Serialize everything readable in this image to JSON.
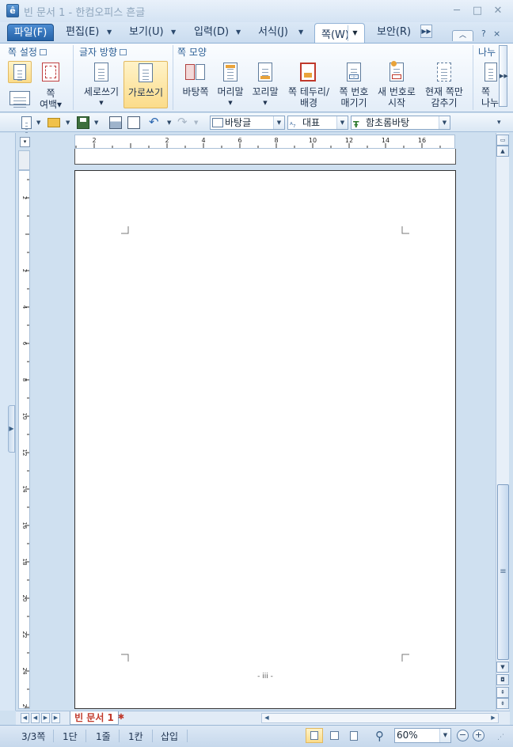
{
  "window": {
    "title": "빈 문서 1 - 한컴오피스 흔글",
    "controls": {
      "minimize": "─",
      "maximize": "□",
      "close": "✕"
    }
  },
  "menu": {
    "tabs": [
      {
        "label": "파일(F)"
      },
      {
        "label": "편집(E)"
      },
      {
        "label": "보기(U)"
      },
      {
        "label": "입력(D)"
      },
      {
        "label": "서식(J)"
      },
      {
        "label": "쪽(W)"
      },
      {
        "label": "보안(R)"
      }
    ],
    "active_tab": "쪽(W)",
    "help": "?",
    "close": "×"
  },
  "ribbon": {
    "groups": {
      "page_setup": {
        "title": "쪽 설정",
        "margin_label": "쪽\n여백▾"
      },
      "text_direction": {
        "title": "글자 방향",
        "vertical_label": "세로쓰기",
        "horizontal_label": "가로쓰기"
      },
      "page_style": {
        "title": "쪽 모양",
        "buttons": [
          {
            "label": "바탕쪽"
          },
          {
            "label": "머리말"
          },
          {
            "label": "꼬리말"
          },
          {
            "label": "쪽 테두리/\n배경"
          },
          {
            "label": "쪽 번호\n매기기"
          },
          {
            "label": "새 번호로\n시작"
          },
          {
            "label": "현재 쪽만\n감추기"
          }
        ]
      },
      "split": {
        "title": "나누",
        "label": "쪽\n나누"
      }
    }
  },
  "toolbar": {
    "style_combo": "바탕글",
    "lang_combo": "대표",
    "font_combo": "함초롬바탕"
  },
  "rulers": {
    "horizontal_ticks": [
      "2",
      "2",
      "4",
      "6",
      "8",
      "10",
      "12",
      "14",
      "16"
    ],
    "vertical_ticks": [
      "2",
      "2",
      "4",
      "6",
      "8",
      "10",
      "12",
      "14",
      "16",
      "18",
      "20",
      "22",
      "24",
      "26"
    ]
  },
  "document": {
    "page_number": "- iii -",
    "tab_label": "빈 문서 1"
  },
  "statusbar": {
    "page": "3/3쪽",
    "section": "1단",
    "line": "1줄",
    "column": "1칸",
    "mode": "삽입",
    "zoom": "60%"
  },
  "colors": {
    "accent": "#2563a8",
    "active_highlight": "#fbdc8a",
    "doc_tab_text": "#c0392b"
  }
}
